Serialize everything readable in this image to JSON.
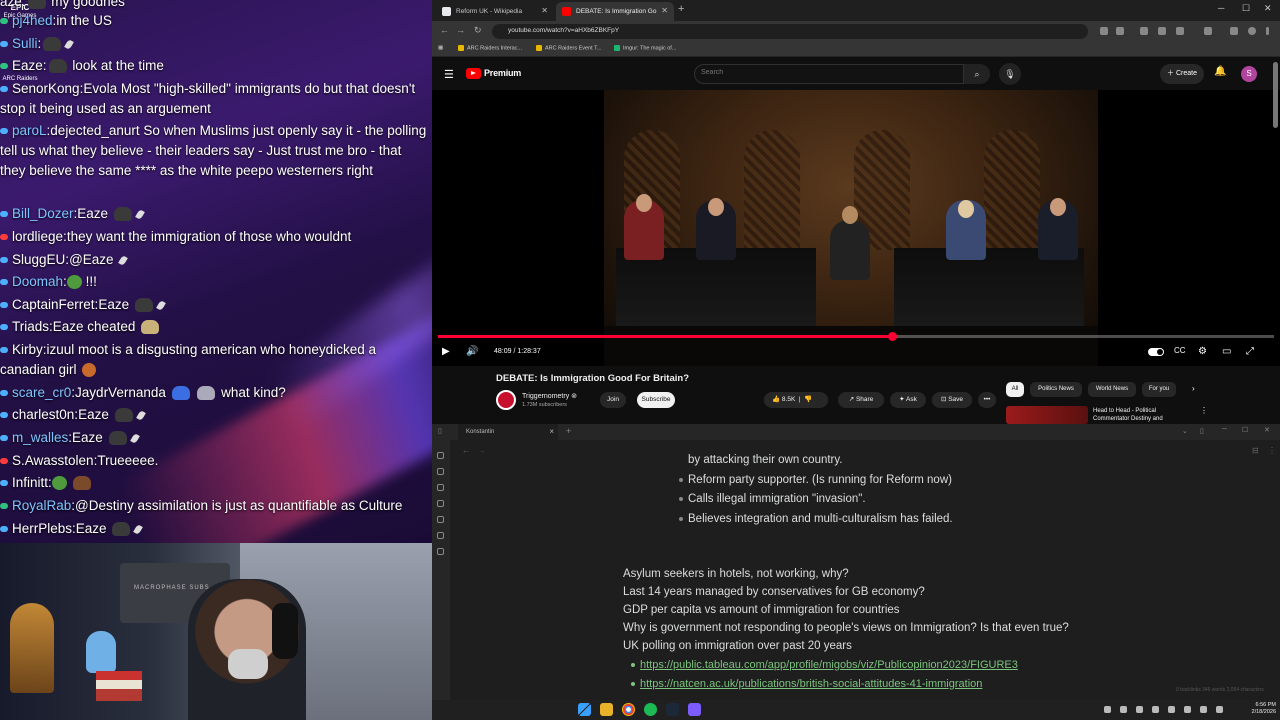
{
  "chat": {
    "sidelogos": [
      "EPIC",
      "Epic Games",
      "ARC Raiders"
    ],
    "messages": [
      {
        "user": "",
        "text": "my goodnes"
      },
      {
        "user": "pj4hed",
        "text": "in the US"
      },
      {
        "user": "Sulli",
        "text": ""
      },
      {
        "user": "Eaze",
        "text": "look at the time"
      },
      {
        "user": "SenorKong",
        "text": "Evola Most \"high-skilled\" immigrants do but that doesn't stop it being used as an arguement"
      },
      {
        "user": "paroL",
        "text": "dejected_anurt So when Muslims just openly say it - the polling tell us what they believe - their leaders say - Just trust me bro - that they believe the same **** as the white peepo westerners right"
      },
      {
        "user": "Bill_Dozer",
        "text": "Eaze"
      },
      {
        "user": "lordliege",
        "text": "they want the immigration of those who wouldnt"
      },
      {
        "user": "SluggEU",
        "text": "@Eaze"
      },
      {
        "user": "Doomah",
        "text": "!!!"
      },
      {
        "user": "CaptainFerret",
        "text": "Eaze"
      },
      {
        "user": "Triads",
        "text": "Eaze cheated"
      },
      {
        "user": "Kirby",
        "text": "izuul moot is a disgusting american who honeydicked a canadian girl"
      },
      {
        "user": "scare_cr0",
        "text": "JaydrVernanda"
      },
      {
        "user": "",
        "text": "what kind?"
      },
      {
        "user": "charlest0n",
        "text": "Eaze"
      },
      {
        "user": "m_walles",
        "text": "Eaze"
      },
      {
        "user": "S.Awasstolen",
        "text": "Trueeeee."
      },
      {
        "user": "Infinitt",
        "text": ""
      },
      {
        "user": "RoyalRab",
        "text": "@Destiny assimilation is just as quantifiable as Culture"
      },
      {
        "user": "HerrPlebs",
        "text": "Eaze"
      }
    ]
  },
  "webcam": {
    "panel_text": "MACROPHASE SUBS"
  },
  "browser": {
    "tabs": [
      {
        "title": "Reform UK - Wikipedia",
        "color": "#e8eaed"
      },
      {
        "title": "DEBATE: Is Immigration Go",
        "color": "#ff0000"
      }
    ],
    "new_tab": "+",
    "url": "youtube.com/watch?v=aHXb6ZBKFpY",
    "bookmarks": [
      "ARC Raiders Interac...",
      "ARC Raiders Event T...",
      "Imgur: The magic of..."
    ]
  },
  "youtube": {
    "brand": "Premium",
    "search_placeholder": "Search",
    "create_label": "Create",
    "avatar_letter": "S",
    "current_time": "48:09 / 1:28:37",
    "progress_fraction": 0.543,
    "video_title": "DEBATE: Is Immigration Good For Britain?",
    "channel_name": "Triggernometry",
    "channel_subs": "1.73M subscribers",
    "join_label": "Join",
    "subscribe_label": "Subscribe",
    "like_count": "8.5K",
    "share_label": "Share",
    "ask_label": "Ask",
    "save_label": "Save",
    "chips": [
      "All",
      "Politics News",
      "World News",
      "For you"
    ],
    "rec_title": "Head to Head - Political Commentator Destiny and",
    "accent": "#ff0033"
  },
  "editor": {
    "tab_label": "Konstantin",
    "lines": [
      {
        "text": "by attacking their own country.",
        "type": "continuation"
      },
      {
        "text": "Reform party supporter. (Is running for Reform now)",
        "type": "bullet"
      },
      {
        "text": "Calls illegal immigration \"invasion\".",
        "type": "bullet"
      },
      {
        "text": "Believes integration and multi-culturalism has failed.",
        "type": "bullet"
      },
      {
        "text": "Asylum seekers in hotels, not working, why?",
        "type": "plain"
      },
      {
        "text": "Last 14 years managed by conservatives for GB economy?",
        "type": "plain"
      },
      {
        "text": "GDP per capita vs amount of immigration for countries",
        "type": "plain"
      },
      {
        "text": "Why is government not responding to people's views on Immigration? Is that even true?",
        "type": "plain"
      },
      {
        "text": "UK polling on immigration over past 20 years",
        "type": "plain"
      },
      {
        "text": "https://public.tableau.com/app/profile/migobs/viz/Publicopinion2023/FIGURE3",
        "type": "link"
      },
      {
        "text": "https://natcen.ac.uk/publications/british-social-attitudes-41-immigration",
        "type": "link"
      }
    ],
    "status": "0 backlinks   346 words   2,094 characters"
  },
  "taskbar": {
    "time": "6:56 PM",
    "date": "2/18/2026"
  }
}
